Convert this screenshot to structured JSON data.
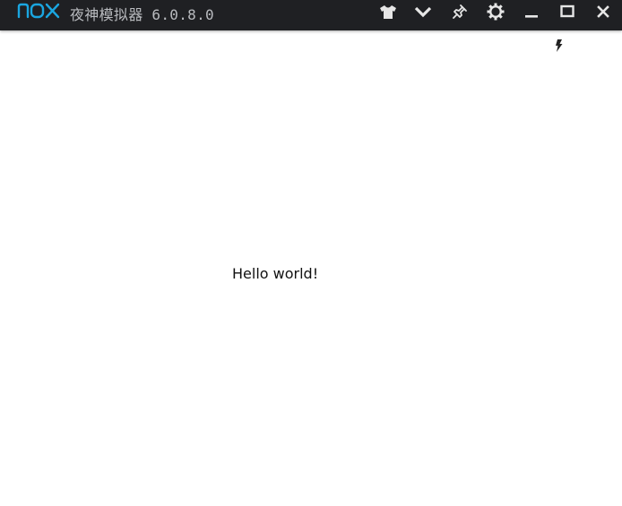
{
  "window": {
    "title": "夜神模拟器 6.0.8.0",
    "logo_text": "nox",
    "brand_color": "#1aa6e0",
    "titlebar_color": "#1f2023"
  },
  "toolbar": {
    "buttons": [
      {
        "name": "skin-button",
        "icon": "shirt-icon"
      },
      {
        "name": "dropdown-button",
        "icon": "chevron-down-icon"
      },
      {
        "name": "pin-button",
        "icon": "pin-icon"
      },
      {
        "name": "settings-button",
        "icon": "gear-icon"
      },
      {
        "name": "minimize-button",
        "icon": "minimize-icon"
      },
      {
        "name": "maximize-button",
        "icon": "maximize-icon"
      },
      {
        "name": "close-button",
        "icon": "close-icon"
      }
    ]
  },
  "statusbar": {
    "icon": "lightning-icon"
  },
  "content": {
    "text": "Hello world!"
  }
}
